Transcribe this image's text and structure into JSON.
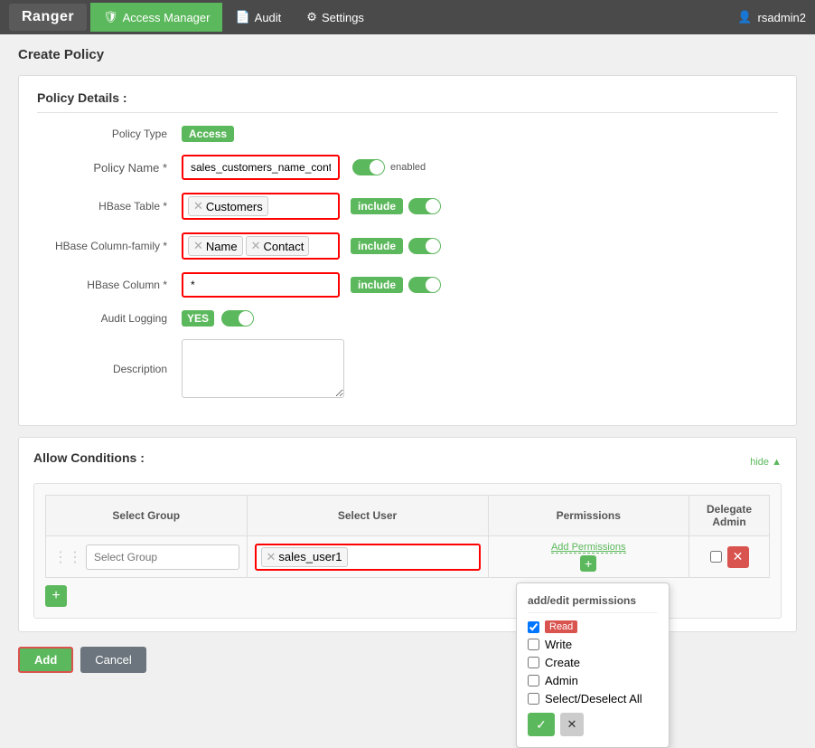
{
  "header": {
    "logo": "Ranger",
    "nav": [
      {
        "label": "Access Manager",
        "icon": "🛡",
        "active": true
      },
      {
        "label": "Audit",
        "icon": "📄",
        "active": false
      },
      {
        "label": "Settings",
        "icon": "⚙",
        "active": false
      }
    ],
    "user": "rsadmin2"
  },
  "page": {
    "title": "Create Policy",
    "breadcrumb": "Create Policy"
  },
  "policy_details": {
    "section_title": "Policy Details :",
    "policy_type_label": "Policy Type",
    "policy_type_value": "Access",
    "policy_name_label": "Policy Name *",
    "policy_name_value": "sales_customers_name_contact",
    "policy_name_enabled_label": "enabled",
    "hbase_table_label": "HBase Table *",
    "hbase_table_tag": "Customers",
    "hbase_table_include": "include",
    "hbase_column_family_label": "HBase Column-family *",
    "hbase_column_family_tags": [
      "Name",
      "Contact"
    ],
    "hbase_column_family_include": "include",
    "hbase_column_label": "HBase Column *",
    "hbase_column_value": "*",
    "hbase_column_include": "include",
    "audit_logging_label": "Audit Logging",
    "audit_logging_value": "YES",
    "description_label": "Description"
  },
  "allow_conditions": {
    "section_title": "Allow Conditions :",
    "hide_label": "hide ▲",
    "table": {
      "headers": [
        "Select Group",
        "Select User",
        "Permissions",
        "Delegate\nAdmin"
      ],
      "rows": [
        {
          "select_group_placeholder": "Select Group",
          "select_user_tags": [
            "sales_user1"
          ],
          "permissions_label": "Add Permissions",
          "delegate_admin": false
        }
      ]
    },
    "add_row_button": "+"
  },
  "permissions_popup": {
    "title": "add/edit permissions",
    "options": [
      {
        "label": "Read",
        "checked": true
      },
      {
        "label": "Write",
        "checked": false
      },
      {
        "label": "Create",
        "checked": false
      },
      {
        "label": "Admin",
        "checked": false
      },
      {
        "label": "Select/Deselect All",
        "checked": false
      }
    ],
    "confirm_icon": "✓",
    "cancel_icon": "✕"
  },
  "buttons": {
    "add_label": "Add",
    "cancel_label": "Cancel"
  }
}
